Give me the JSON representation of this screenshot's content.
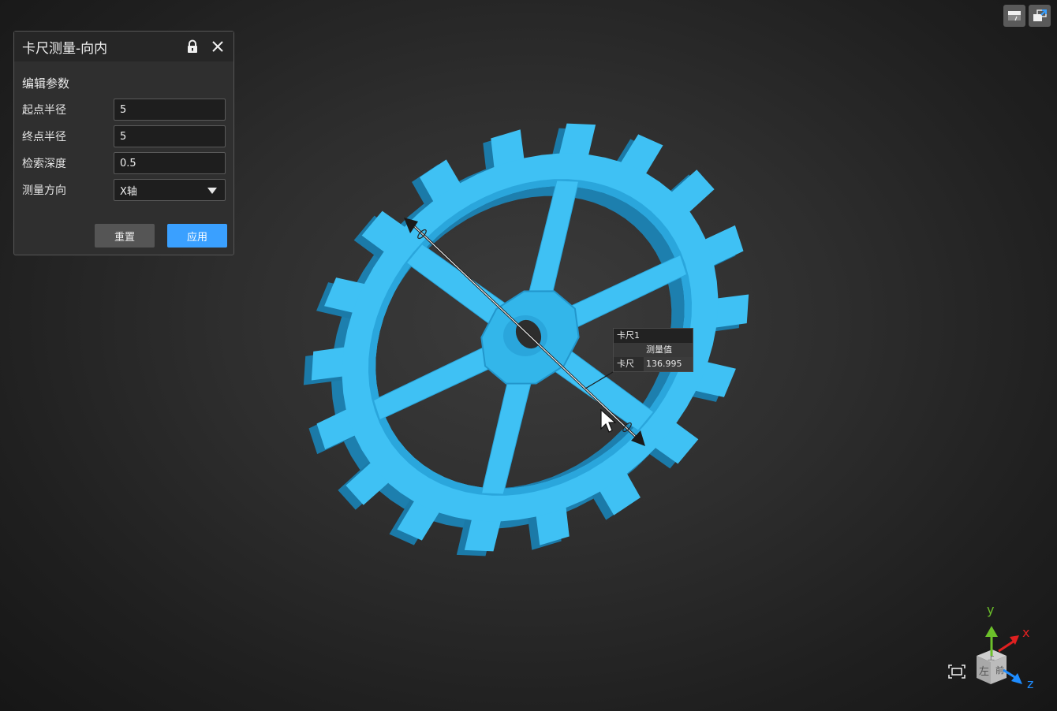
{
  "panel": {
    "title": "卡尺测量-向内",
    "section": "编辑参数",
    "fields": [
      {
        "label": "起点半径",
        "value": "5"
      },
      {
        "label": "终点半径",
        "value": "5"
      },
      {
        "label": "检索深度",
        "value": "0.5"
      }
    ],
    "direction": {
      "label": "测量方向",
      "value": "X轴"
    },
    "reset_label": "重置",
    "apply_label": "应用",
    "icons": {
      "lock": "lock-icon",
      "close": "close-icon"
    }
  },
  "toolbar": {
    "icons": [
      "panel-toggle-icon",
      "view-switch-icon"
    ]
  },
  "model": {
    "color": "#3fc1f4",
    "tooth_count": 18
  },
  "measurement": {
    "title": "卡尺1",
    "header": "测量值",
    "row_label": "卡尺",
    "value": "136.995"
  },
  "axis_widget": {
    "x": "x",
    "y": "y",
    "z": "z",
    "cube_face_left": "左",
    "cube_face_front": "前",
    "cube_face_top": "上",
    "colors": {
      "x": "#e02020",
      "y": "#6cc02a",
      "z": "#1e8cff"
    }
  },
  "accent": "#3aa0ff"
}
